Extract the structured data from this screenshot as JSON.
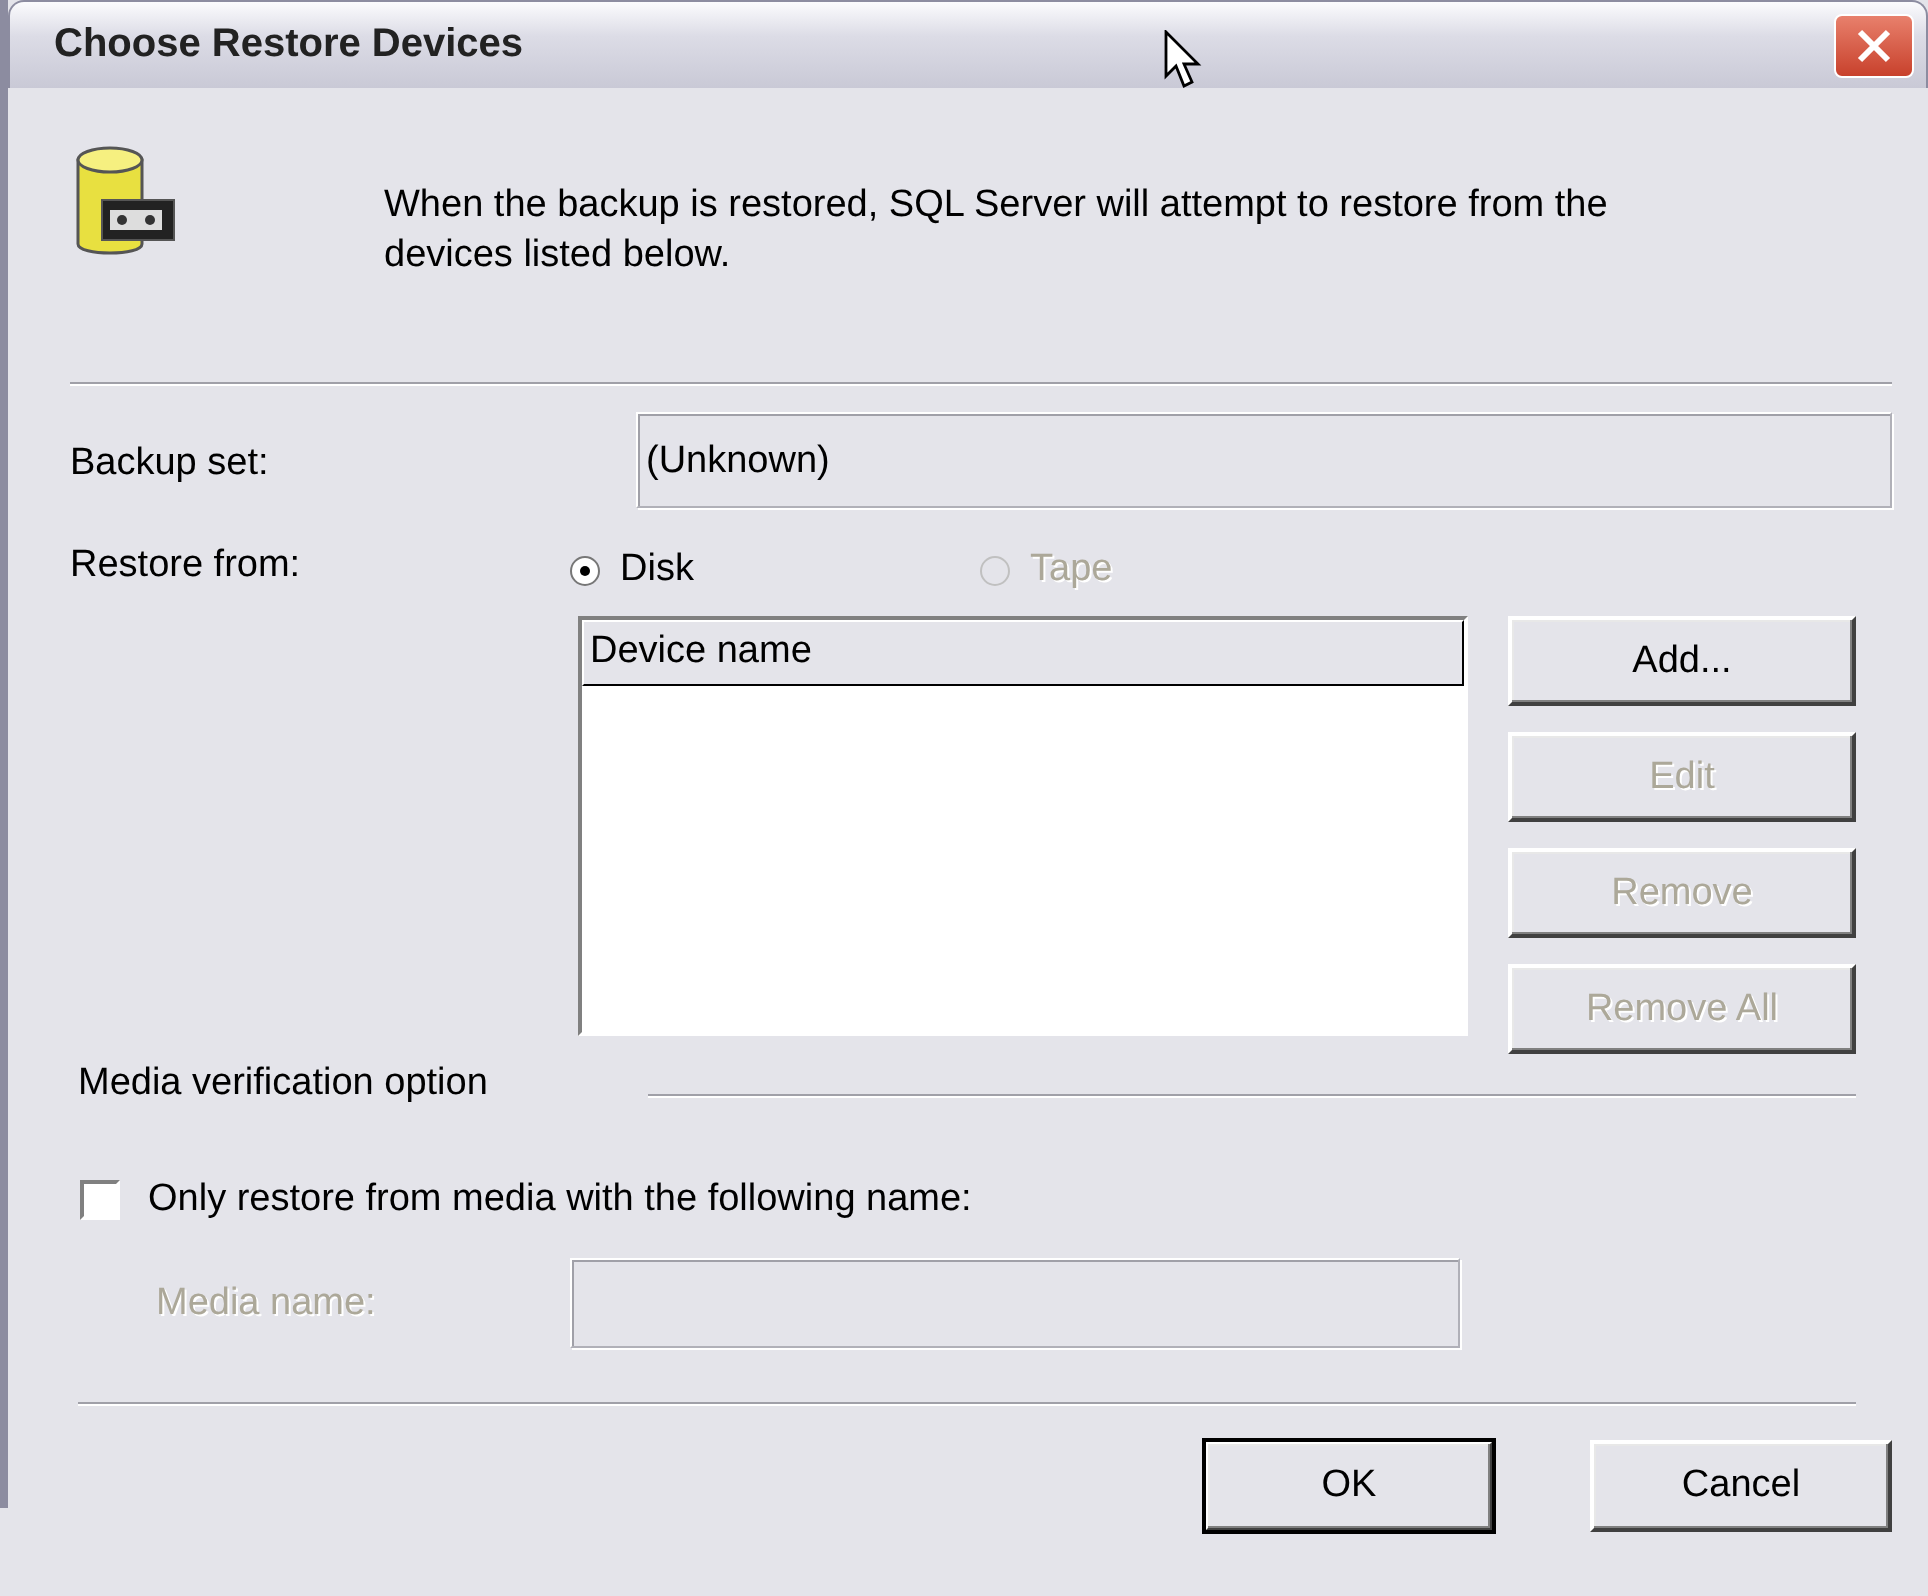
{
  "window": {
    "title": "Choose Restore Devices"
  },
  "intro": "When the backup is restored, SQL Server will attempt to restore from the devices listed below.",
  "backup_set": {
    "label": "Backup set:",
    "value": "(Unknown)"
  },
  "restore_from": {
    "label": "Restore from:",
    "options": [
      {
        "label": "Disk",
        "selected": true,
        "disabled": false
      },
      {
        "label": "Tape",
        "selected": false,
        "disabled": true
      }
    ]
  },
  "device_list": {
    "columns": [
      "Device name"
    ]
  },
  "device_buttons": [
    {
      "label": "Add...",
      "disabled": false
    },
    {
      "label": "Edit",
      "disabled": true
    },
    {
      "label": "Remove",
      "disabled": true
    },
    {
      "label": "Remove All",
      "disabled": true
    }
  ],
  "media_verification": {
    "title": "Media verification option",
    "checkbox": {
      "label": "Only restore from media with the following name:",
      "checked": false
    },
    "media_name": {
      "label": "Media name:",
      "disabled": true
    }
  },
  "buttons": [
    {
      "label": "OK",
      "default": true
    },
    {
      "label": "Cancel",
      "default": false
    }
  ]
}
